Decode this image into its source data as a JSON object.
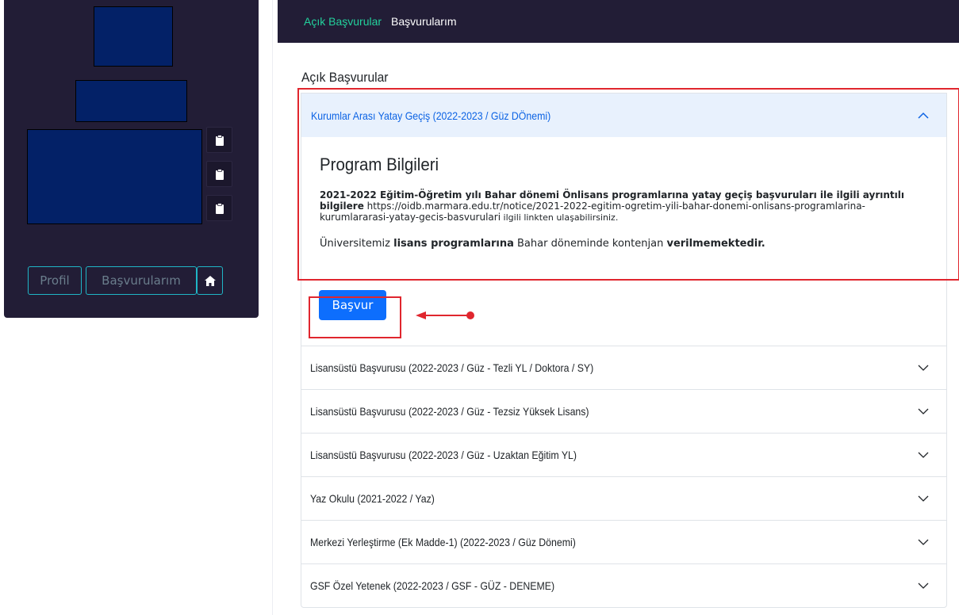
{
  "sidebar": {
    "buttons": {
      "profil": "Profil",
      "basvurularim": "Başvurularım",
      "home_icon": "home-icon"
    },
    "clip_icon": "clipboard-icon"
  },
  "topnav": {
    "items": [
      {
        "label": "Açık Başvurular",
        "active": true
      },
      {
        "label": "Başvurularım",
        "active": false
      }
    ]
  },
  "main": {
    "section_title": "Açık Başvurular",
    "open_item": {
      "title": "Kurumlar Arası Yatay Geçiş (2022-2023 / Güz DÖnemi)",
      "program_title": "Program Bilgileri",
      "desc_bold": "2021-2022 Eğitim-Öğretim yılı Bahar dönemi Önlisans  programlarına yatay geçiş başvuruları ile ilgili ayrıntılı bilgilere",
      "desc_link": " https://oidb.marmara.edu.tr/notice/2021-2022-egitim-ogretim-yili-bahar-donemi-onlisans-programlarina-kurumlararasi-yatay-gecis-basvurulari",
      "desc_tail": " ilgili linkten ulaşabilirsiniz.",
      "desc2_a": "Üniversitemiz ",
      "desc2_b": "lisans programlarına",
      "desc2_c": " Bahar döneminde kontenjan ",
      "desc2_d": "verilmemektedir.",
      "apply_button": "Başvur"
    },
    "items": [
      "Lisansüstü Başvurusu (2022-2023 / Güz - Tezli YL / Doktora / SY)",
      "Lisansüstü Başvurusu (2022-2023 / Güz - Tezsiz Yüksek Lisans)",
      "Lisansüstü Başvurusu (2022-2023 / Güz - Uzaktan Eğitim YL)",
      "Yaz Okulu (2021-2022 / Yaz)",
      "Merkezi Yerleştirme (Ek Madde-1) (2022-2023 / Güz Dönemi)",
      "GSF Özel Yetenek (2022-2023 / GSF - GÜZ - DENEME)"
    ]
  },
  "colors": {
    "sidebar_bg": "#221d36",
    "block_fill": "#032167",
    "accent_teal": "#1fb6c6",
    "nav_active": "#22d19c",
    "primary": "#0d6efd",
    "annotation_red": "#e0262e"
  }
}
